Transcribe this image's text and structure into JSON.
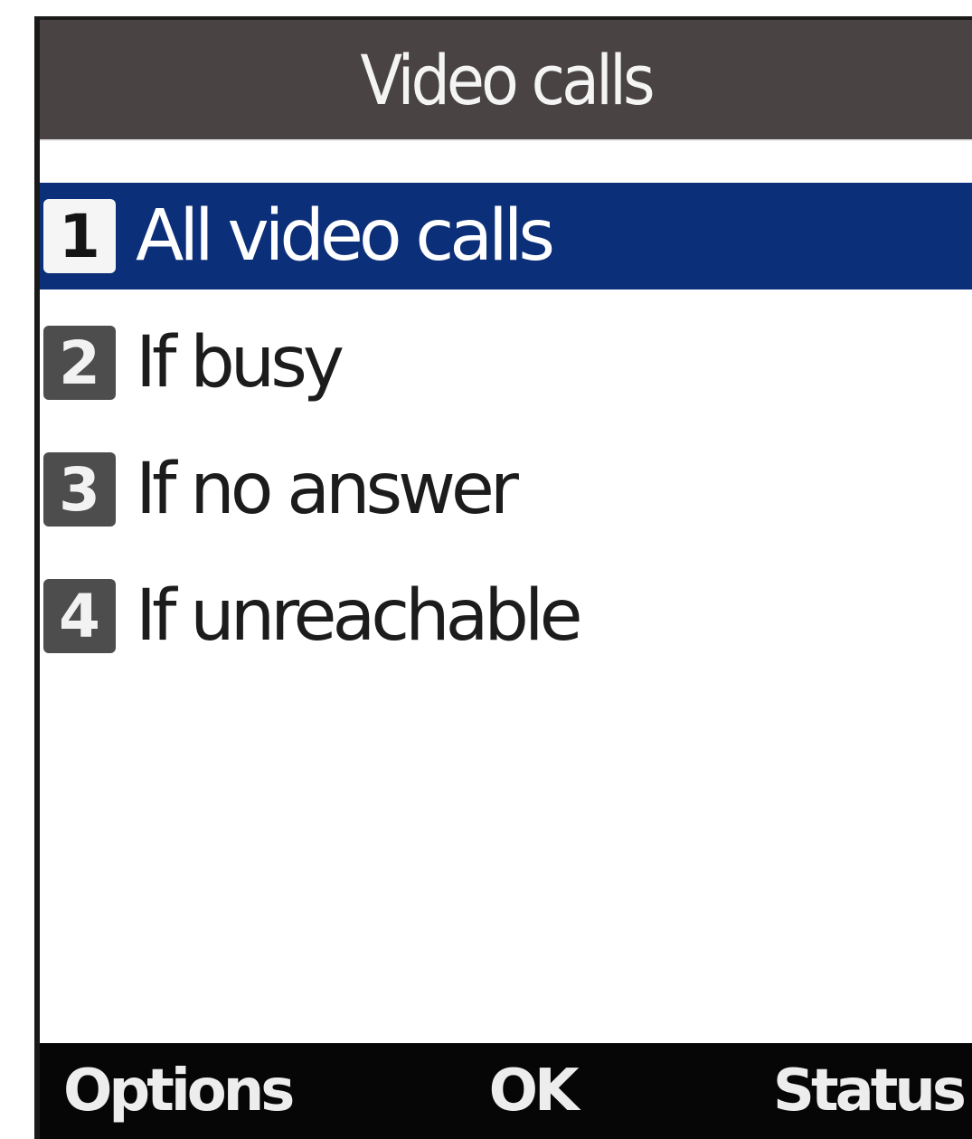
{
  "screen": {
    "title": "Video calls"
  },
  "menu": {
    "items": [
      {
        "number": "1",
        "label": "All video calls",
        "selected": true
      },
      {
        "number": "2",
        "label": "If busy",
        "selected": false
      },
      {
        "number": "3",
        "label": "If no answer",
        "selected": false
      },
      {
        "number": "4",
        "label": "If unreachable",
        "selected": false
      }
    ]
  },
  "softkeys": {
    "left": "Options",
    "center": "OK",
    "right": "Status"
  },
  "colors": {
    "title_bar": "#4a4343",
    "selection": "#0b2f78",
    "softkey_bar": "#060606",
    "number_badge": "#4d4d4d"
  }
}
